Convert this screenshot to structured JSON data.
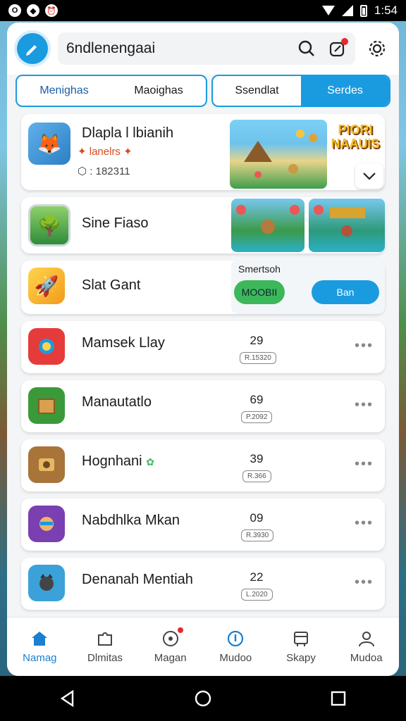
{
  "status_bar": {
    "time": "1:54"
  },
  "header": {
    "search_text": "6ndlenengaai",
    "logo_icon": "pencil-icon",
    "search_icon": "search-icon",
    "edit_icon": "edit-icon",
    "settings_icon": "gear-icon"
  },
  "tabs": {
    "group1": [
      "Menighas",
      "Maoighas"
    ],
    "group2": [
      "Ssendlat",
      "Serdes"
    ]
  },
  "featured": {
    "title": "Dlapla l lbianih",
    "subtitle": "lanelrs",
    "downloads": ": 182311",
    "banner_text": "PIORI NAAUIS"
  },
  "second": {
    "title": "Sine Fiaso"
  },
  "third": {
    "title": "Slat Gant",
    "header": "Smertsoh",
    "btn_green": "MOOBII",
    "btn_blue": "Ban"
  },
  "apps": [
    {
      "title": "Mamsek Llay",
      "rating": "29",
      "badge": "R.15320"
    },
    {
      "title": "Manautatlo",
      "rating": "69",
      "badge": "P.2092"
    },
    {
      "title": "Hognhani",
      "rating": "39",
      "badge": "R.366"
    },
    {
      "title": "Nabdhlka Mkan",
      "rating": "09",
      "badge": "R.3930"
    },
    {
      "title": "Denanah Mentiah",
      "rating": "22",
      "badge": "L.2020"
    }
  ],
  "more_label": "•••",
  "bottom_nav": [
    {
      "label": "Namag",
      "icon": "home-icon"
    },
    {
      "label": "Dlmitas",
      "icon": "puzzle-icon"
    },
    {
      "label": "Magan",
      "icon": "compass-icon"
    },
    {
      "label": "Mudoo",
      "icon": "info-icon"
    },
    {
      "label": "Skapy",
      "icon": "shop-icon"
    },
    {
      "label": "Mudoa",
      "icon": "profile-icon"
    }
  ],
  "colors": {
    "accent": "#1a9be0",
    "green": "#3cb85a",
    "badge_red": "#e52a2a"
  }
}
